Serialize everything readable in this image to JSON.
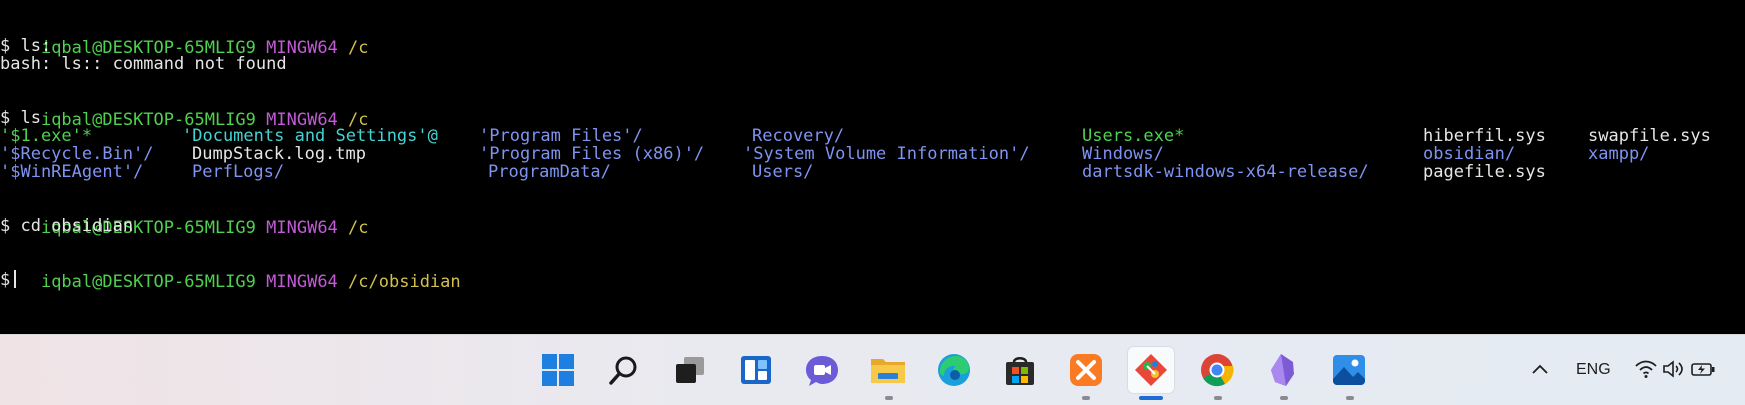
{
  "terminal": {
    "prompt1": {
      "user": "iqbal@DESKTOP-65MLIG9",
      "system": "MINGW64",
      "path": "/c"
    },
    "cmd1": "$ ls:",
    "out1": "bash: ls:: command not found",
    "prompt2": {
      "user": "iqbal@DESKTOP-65MLIG9",
      "system": "MINGW64",
      "path": "/c"
    },
    "cmd2": "$ ls",
    "listing": {
      "row1": {
        "c1": "'$1.exe'*",
        "c2": "'Documents and Settings'@",
        "c3": "'Program Files'/",
        "c4": "Recovery/",
        "c5": "Users.exe*",
        "c6": "hiberfil.sys",
        "c7": "swapfile.sys"
      },
      "row2": {
        "c1": "'$Recycle.Bin'/",
        "c2": "DumpStack.log.tmp",
        "c3": "'Program Files (x86)'/",
        "c4": "'System Volume Information'/",
        "c5": "Windows/",
        "c6": "obsidian/",
        "c7": "xampp/"
      },
      "row3": {
        "c1": "'$WinREAgent'/",
        "c2": "PerfLogs/",
        "c3": "ProgramData/",
        "c4": "Users/",
        "c5": "dartsdk-windows-x64-release/",
        "c6": "pagefile.sys"
      }
    },
    "prompt3": {
      "user": "iqbal@DESKTOP-65MLIG9",
      "system": "MINGW64",
      "path": "/c"
    },
    "cmd3": "$ cd obsidian",
    "prompt4": {
      "user": "iqbal@DESKTOP-65MLIG9",
      "system": "MINGW64",
      "path": "/c/obsidian"
    },
    "cmd4": "$ "
  },
  "colors": {
    "background": "#000000",
    "text": "#e6e6e6",
    "user": "#4ed14e",
    "system": "#c25bd6",
    "path": "#d1c14a",
    "directory": "#7f93f2",
    "symlink": "#44d3d3",
    "executable": "#4ed14e"
  },
  "taskbar": {
    "icons": [
      "windows-start-icon",
      "search-icon",
      "task-view-icon",
      "widgets-icon",
      "teams-chat-icon",
      "file-explorer-icon",
      "edge-browser-icon",
      "microsoft-store-icon",
      "xampp-icon",
      "git-bash-icon",
      "chrome-icon",
      "obsidian-icon",
      "photos-icon"
    ],
    "tray": {
      "language": "ENG"
    }
  }
}
